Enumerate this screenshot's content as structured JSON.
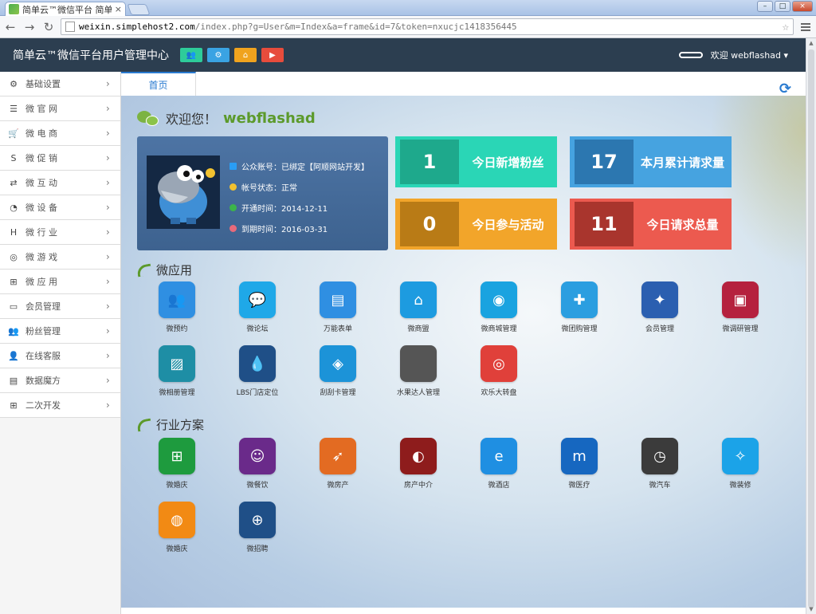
{
  "browser": {
    "tab_title": "简单云™微信平台 简单云™",
    "tab_close": "×",
    "win_min": "–",
    "win_max": "□",
    "win_close": "×",
    "back": "←",
    "forward": "→",
    "reload": "↻",
    "url_host": "weixin.simplehost2.com",
    "url_path": "/index.php?g=User&m=Index&a=frame&id=7&token=nxucjc1418356445",
    "star": "☆"
  },
  "topbar": {
    "brand": "简单云™微信平台用户管理中心",
    "quick_buttons": [
      {
        "icon": "users-icon",
        "glyph": "👥",
        "color": "#2ecc9a"
      },
      {
        "icon": "gear-icon",
        "glyph": "⚙",
        "color": "#3aa3e3"
      },
      {
        "icon": "home-icon",
        "glyph": "⌂",
        "color": "#f0a31e"
      },
      {
        "icon": "play-icon",
        "glyph": "▶",
        "color": "#e74c3c"
      }
    ],
    "welcome": "欢迎 webflashad ▾"
  },
  "sidebar": {
    "items": [
      {
        "label": "基础设置",
        "icon": "gear-icon",
        "glyph": "⚙"
      },
      {
        "label": "微 官 网",
        "icon": "list-icon",
        "glyph": "☰"
      },
      {
        "label": "微 电 商",
        "icon": "cart-icon",
        "glyph": "🛒"
      },
      {
        "label": "微 促 销",
        "icon": "skype-icon",
        "glyph": "S"
      },
      {
        "label": "微 互 动",
        "icon": "retweet-icon",
        "glyph": "⇄"
      },
      {
        "label": "微 设 备",
        "icon": "rss-icon",
        "glyph": "◔"
      },
      {
        "label": "微 行 业",
        "icon": "h-square-icon",
        "glyph": "H"
      },
      {
        "label": "微 游 戏",
        "icon": "gamepad-icon",
        "glyph": "◎"
      },
      {
        "label": "微 应 用",
        "icon": "windows-icon",
        "glyph": "⊞"
      },
      {
        "label": "会员管理",
        "icon": "card-icon",
        "glyph": "▭"
      },
      {
        "label": "粉丝管理",
        "icon": "group-icon",
        "glyph": "👥"
      },
      {
        "label": "在线客服",
        "icon": "user-icon",
        "glyph": "👤"
      },
      {
        "label": "数据魔方",
        "icon": "bar-chart-icon",
        "glyph": "▤"
      },
      {
        "label": "二次开发",
        "icon": "windows-icon",
        "glyph": "⊞"
      }
    ],
    "chevron": "›"
  },
  "page_tab": "首页",
  "refresh_glyph": "⟳",
  "welcome": {
    "prefix": "欢迎您！",
    "user": "webflashad"
  },
  "profile": {
    "account": "公众账号：已绑定【阿顺网站开发】",
    "status": "帐号状态：正常",
    "open_time": "开通时间：2014-12-11",
    "expire_time": "到期时间：2016-03-31"
  },
  "stats": [
    {
      "value": "1",
      "label": "今日新增粉丝",
      "bg": "#2ad6b6",
      "num_bg": "#1ea98c"
    },
    {
      "value": "17",
      "label": "本月累计请求量",
      "bg": "#46a3e0",
      "num_bg": "#2c77b0"
    },
    {
      "value": "0",
      "label": "今日参与活动",
      "bg": "#f2a52a",
      "num_bg": "#b97b16"
    },
    {
      "value": "11",
      "label": "今日请求总量",
      "bg": "#ec5a4f",
      "num_bg": "#a9352d"
    }
  ],
  "sections": {
    "apps_title": "微应用",
    "industry_title": "行业方案"
  },
  "apps": [
    {
      "name": "微预约",
      "icon": "users-icon",
      "glyph": "👥",
      "color": "#2f8fe2"
    },
    {
      "name": "微论坛",
      "icon": "chat-icon",
      "glyph": "💬",
      "color": "#1fa8e8"
    },
    {
      "name": "万能表单",
      "icon": "cards-icon",
      "glyph": "▤",
      "color": "#2f8fe2"
    },
    {
      "name": "微商盟",
      "icon": "house-icon",
      "glyph": "⌂",
      "color": "#1d9be0"
    },
    {
      "name": "微商城管理",
      "icon": "film-icon",
      "glyph": "◉",
      "color": "#1aa3e0"
    },
    {
      "name": "微团购管理",
      "icon": "tools-icon",
      "glyph": "✚",
      "color": "#2b9ee0"
    },
    {
      "name": "会员管理",
      "icon": "bird-icon",
      "glyph": "✦",
      "color": "#2b5fb0"
    },
    {
      "name": "微调研管理",
      "icon": "newspaper-icon",
      "glyph": "▣",
      "color": "#b5213e"
    },
    {
      "name": "微相册管理",
      "icon": "image-icon",
      "glyph": "▨",
      "color": "#1e8ea5"
    },
    {
      "name": "LBS门店定位",
      "icon": "drop-icon",
      "glyph": "💧",
      "color": "#1f4f87"
    },
    {
      "name": "刮刮卡管理",
      "icon": "dropbox-icon",
      "glyph": "◈",
      "color": "#1c93d8"
    },
    {
      "name": "水果达人管理",
      "icon": "apple-icon",
      "glyph": "",
      "color": "#555555"
    },
    {
      "name": "欢乐大转盘",
      "icon": "chrome-icon",
      "glyph": "◎",
      "color": "#e0403a"
    }
  ],
  "industry": [
    {
      "name": "微婚庆",
      "icon": "store-icon",
      "glyph": "⊞",
      "color": "#1e9b3e"
    },
    {
      "name": "微餐饮",
      "icon": "smile-icon",
      "glyph": "☺",
      "color": "#6a2a8a"
    },
    {
      "name": "微房产",
      "icon": "rocket-icon",
      "glyph": "➶",
      "color": "#e36b22"
    },
    {
      "name": "房产中介",
      "icon": "speed-icon",
      "glyph": "◐",
      "color": "#8e1c1c"
    },
    {
      "name": "微酒店",
      "icon": "ie-icon",
      "glyph": "e",
      "color": "#1f8fe2"
    },
    {
      "name": "微医疗",
      "icon": "maxthon-icon",
      "glyph": "m",
      "color": "#1667c0"
    },
    {
      "name": "微汽车",
      "icon": "clock-icon",
      "glyph": "◷",
      "color": "#3b3b3b"
    },
    {
      "name": "微装修",
      "icon": "safari-icon",
      "glyph": "✧",
      "color": "#1ba3e8"
    },
    {
      "name": "微婚庆",
      "icon": "firefox-icon",
      "glyph": "◍",
      "color": "#f28a14"
    },
    {
      "name": "微招聘",
      "icon": "globe-icon",
      "glyph": "⊕",
      "color": "#1f4f87"
    }
  ]
}
